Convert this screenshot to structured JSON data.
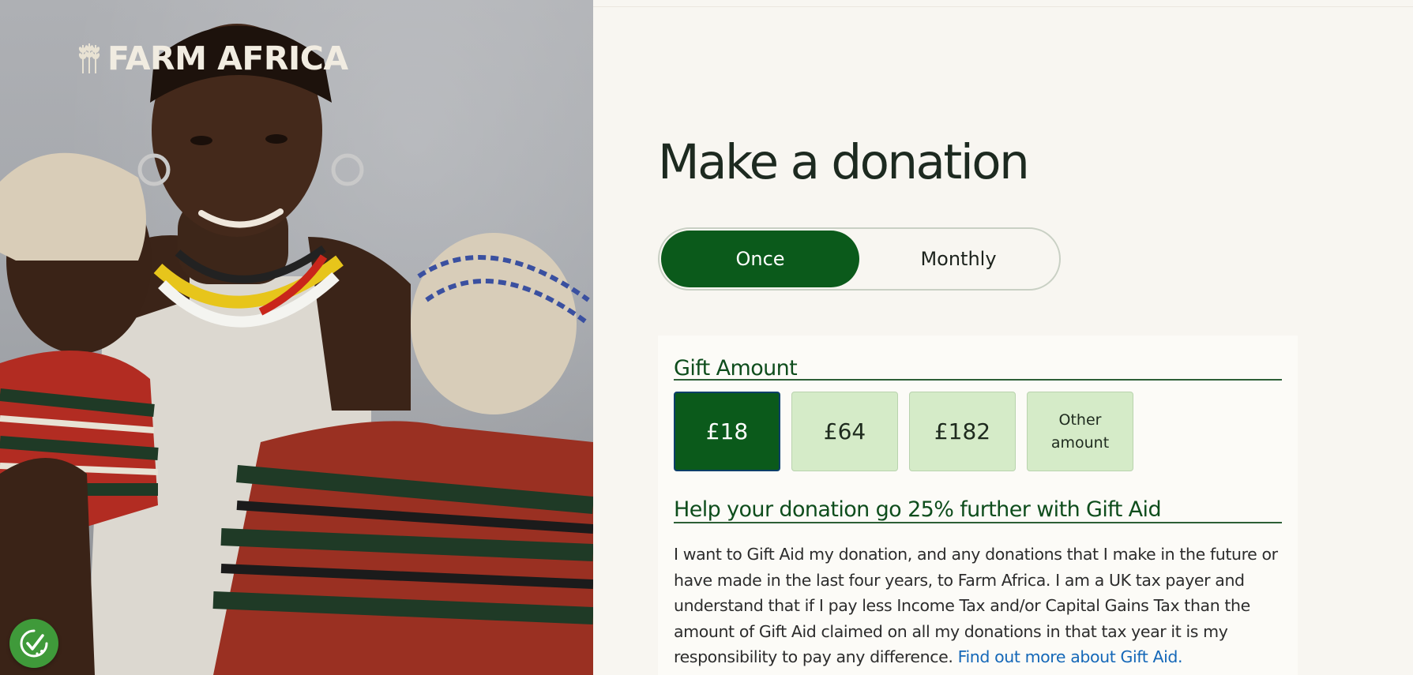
{
  "brand": {
    "logo_text": "FARM AFRICA"
  },
  "hero_image": {
    "description_icon": "photo-woman-with-two-babies"
  },
  "consent_badge": {
    "icon": "cookie-consent-check-icon",
    "color": "#3f9a3a"
  },
  "page": {
    "title": "Make a donation"
  },
  "frequency": {
    "options": [
      {
        "label": "Once",
        "selected": true
      },
      {
        "label": "Monthly",
        "selected": false
      }
    ]
  },
  "gift_amount": {
    "heading": "Gift Amount",
    "options": [
      {
        "label": "£18",
        "selected": true
      },
      {
        "label": "£64",
        "selected": false
      },
      {
        "label": "£182",
        "selected": false
      },
      {
        "label": "Other\namount",
        "selected": false
      }
    ]
  },
  "gift_aid": {
    "heading": "Help your donation go 25% further with Gift Aid",
    "body": "I want to Gift Aid my donation, and any donations that I make in the future or have made in the last four years, to Farm Africa. I am a UK tax payer and understand that if I pay less Income Tax and/or Capital Gains Tax than the amount of Gift Aid claimed on all my donations in that tax year it is my responsibility to pay any difference.",
    "link_text": "Find out more about Gift Aid."
  },
  "colors": {
    "brand_green": "#0b5a1b",
    "amount_tile": "#d5ebc8",
    "heading_green": "#0e4d1c",
    "link_blue": "#1568b8",
    "panel_bg": "#f8f6f1"
  }
}
